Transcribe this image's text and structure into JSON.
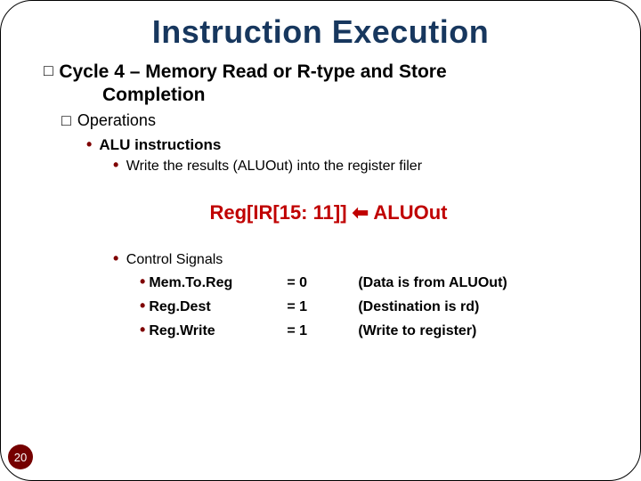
{
  "title": "Instruction Execution",
  "heading": {
    "prefix": "Cycle 4",
    "sep": " – ",
    "rest": "Memory Read or R-type and Store",
    "cont": "Completion"
  },
  "operations_label": "Operations",
  "alu_label": "ALU instructions",
  "write_line": "Write the results (ALUOut) into the register filer",
  "reg_expr": "Reg[IR[15: 11]]",
  "reg_target": "ALUOut",
  "arrow": "⬅",
  "control_label": "Control Signals",
  "signals": [
    {
      "name": "Mem.To.Reg",
      "val": "= 0",
      "desc": "(Data is from ALUOut)"
    },
    {
      "name": "Reg.Dest",
      "val": "= 1",
      "desc": "(Destination is rd)"
    },
    {
      "name": "Reg.Write",
      "val": "= 1",
      "desc": "(Write to register)"
    }
  ],
  "page": "20"
}
